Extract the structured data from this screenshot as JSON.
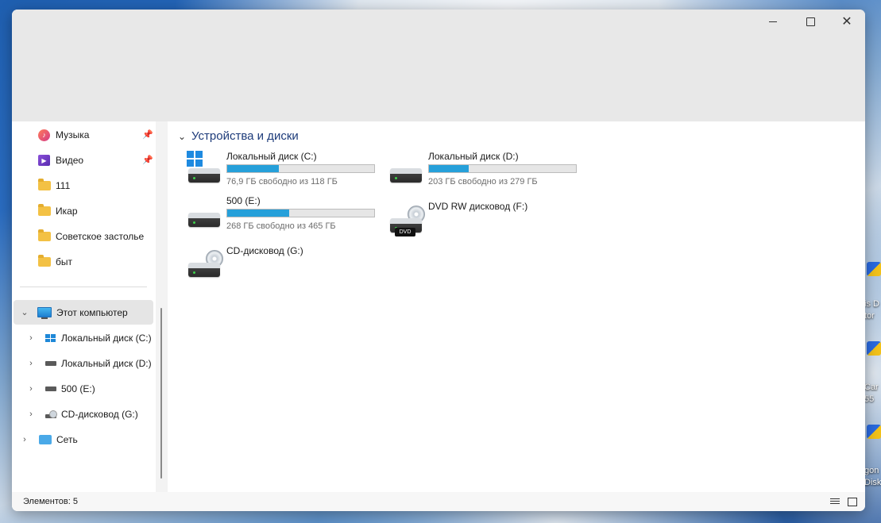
{
  "window": {
    "buttons": {
      "minimize": "—",
      "maximize": "□",
      "close": "✕"
    }
  },
  "nav": {
    "quick": [
      {
        "label": "Музыка",
        "icon": "music-icon",
        "pinned": true
      },
      {
        "label": "Видео",
        "icon": "video-icon",
        "pinned": true
      },
      {
        "label": "111",
        "icon": "folder-icon",
        "pinned": false
      },
      {
        "label": "Икар",
        "icon": "folder-icon",
        "pinned": false
      },
      {
        "label": "Советское застолье",
        "icon": "folder-icon",
        "pinned": false
      },
      {
        "label": "быт",
        "icon": "folder-icon",
        "pinned": false
      }
    ],
    "this_pc": "Этот компьютер",
    "drives": [
      {
        "label": "Локальный диск (C:)",
        "icon": "windows-drive-icon"
      },
      {
        "label": "Локальный диск (D:)",
        "icon": "hdd-icon"
      },
      {
        "label": "500 (E:)",
        "icon": "hdd-icon"
      },
      {
        "label": "CD-дисковод (G:)",
        "icon": "cd-drive-icon"
      }
    ],
    "network": "Сеть"
  },
  "content": {
    "section_title": "Устройства и диски",
    "drives": [
      {
        "name": "Локальный диск (C:)",
        "free": "76,9 ГБ свободно из 118 ГБ",
        "used_fraction": 0.35,
        "type": "system"
      },
      {
        "name": "Локальный диск (D:)",
        "free": "203 ГБ свободно из 279 ГБ",
        "used_fraction": 0.27,
        "type": "hdd"
      },
      {
        "name": "500 (E:)",
        "free": "268 ГБ свободно из 465 ГБ",
        "used_fraction": 0.42,
        "type": "hdd"
      },
      {
        "name": "DVD RW дисковод (F:)",
        "type": "dvd",
        "tag": "DVD"
      },
      {
        "name": "CD-дисковод (G:)",
        "type": "cd"
      }
    ]
  },
  "status": {
    "items_text": "Элементов: 5"
  },
  "desktop": {
    "labels": [
      "is D",
      "tor",
      "Car",
      "55",
      "gon",
      "Disk"
    ]
  },
  "colors": {
    "accent": "#26a0da",
    "titlebar": "#e8e8e8",
    "selection": "#e5e5e5"
  }
}
